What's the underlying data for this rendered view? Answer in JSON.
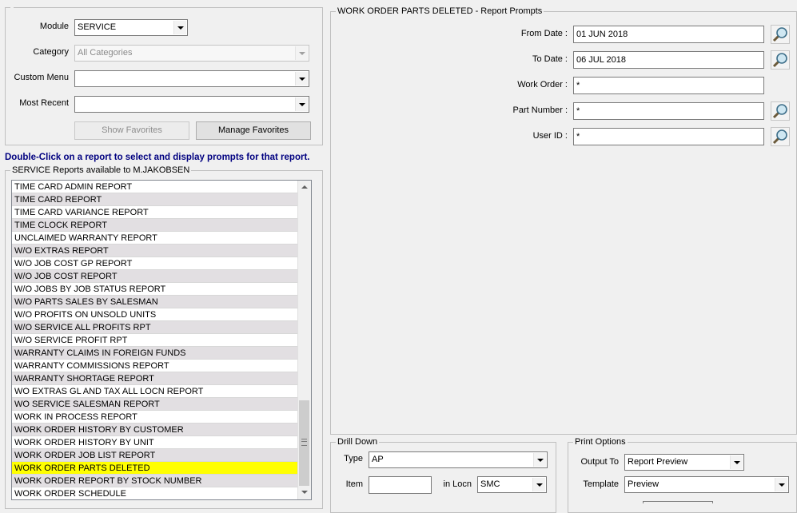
{
  "left": {
    "module_label": "Module",
    "module_value": "SERVICE",
    "category_label": "Category",
    "category_value": "All Categories",
    "custom_menu_label": "Custom Menu",
    "custom_menu_value": "",
    "most_recent_label": "Most Recent",
    "most_recent_value": "",
    "show_favorites_label": "Show Favorites",
    "manage_favorites_label": "Manage Favorites",
    "instruction": "Double-Click on a report to select and display prompts for that report.",
    "reports_legend": "SERVICE Reports available to M.JAKOBSEN"
  },
  "reports": [
    "TIME CARD ADMIN REPORT",
    "TIME CARD REPORT",
    "TIME CARD VARIANCE REPORT",
    "TIME CLOCK REPORT",
    "UNCLAIMED WARRANTY REPORT",
    "W/O EXTRAS REPORT",
    "W/O JOB COST GP REPORT",
    "W/O JOB COST REPORT",
    "W/O JOBS BY JOB STATUS REPORT",
    "W/O PARTS SALES BY SALESMAN",
    "W/O PROFITS ON UNSOLD UNITS",
    "W/O SERVICE ALL PROFITS RPT",
    "W/O SERVICE PROFIT RPT",
    "WARRANTY CLAIMS IN FOREIGN FUNDS",
    "WARRANTY COMMISSIONS REPORT",
    "WARRANTY SHORTAGE REPORT",
    "WO EXTRAS GL AND TAX ALL LOCN REPORT",
    "WO SERVICE SALESMAN REPORT",
    "WORK IN PROCESS REPORT",
    "WORK ORDER HISTORY BY CUSTOMER",
    "WORK ORDER HISTORY BY UNIT",
    "WORK ORDER JOB LIST REPORT",
    "WORK ORDER PARTS DELETED",
    "WORK ORDER REPORT BY STOCK NUMBER",
    "WORK ORDER SCHEDULE"
  ],
  "selected_report_index": 22,
  "prompts": {
    "legend": "WORK ORDER PARTS DELETED - Report Prompts",
    "from_date_label": "From Date :",
    "from_date_value": "01 JUN 2018",
    "to_date_label": "To Date :",
    "to_date_value": "06 JUL 2018",
    "work_order_label": "Work Order :",
    "work_order_value": "*",
    "part_number_label": "Part Number :",
    "part_number_value": "*",
    "user_id_label": "User ID :",
    "user_id_value": "*"
  },
  "drill": {
    "legend": "Drill Down",
    "type_label": "Type",
    "type_value": "AP",
    "item_label": "Item",
    "item_value": "",
    "locn_label": "in Locn",
    "locn_value": "SMC"
  },
  "print": {
    "legend": "Print Options",
    "output_label": "Output To",
    "output_value": "Report Preview",
    "template_label": "Template",
    "template_value": "Preview"
  }
}
